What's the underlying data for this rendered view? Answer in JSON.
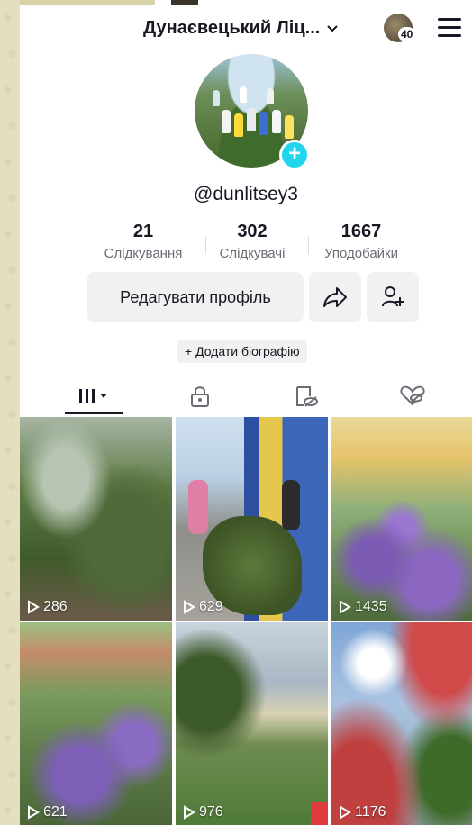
{
  "header": {
    "username": "Дунаєвецький Ліц...",
    "notification_count": "40"
  },
  "profile": {
    "handle": "@dunlitsey3",
    "stats": [
      {
        "value": "21",
        "label": "Слідкування"
      },
      {
        "value": "302",
        "label": "Слідкувачі"
      },
      {
        "value": "1667",
        "label": "Уподобайки"
      }
    ],
    "edit_button": "Редагувати профіль",
    "add_bio": "+ Додати біографію"
  },
  "tabs": [
    {
      "icon": "grid-icon",
      "selected": true
    },
    {
      "icon": "lock-icon",
      "selected": false
    },
    {
      "icon": "reposts-icon",
      "selected": false
    },
    {
      "icon": "liked-hidden-icon",
      "selected": false
    }
  ],
  "videos": [
    {
      "views": "286"
    },
    {
      "views": "629"
    },
    {
      "views": "1435"
    },
    {
      "views": "621"
    },
    {
      "views": "976"
    },
    {
      "views": "1176"
    }
  ],
  "colors": {
    "accent": "#20d5ec",
    "text": "#161823",
    "muted": "#6b6d75",
    "button_bg": "#f1f1f2"
  }
}
